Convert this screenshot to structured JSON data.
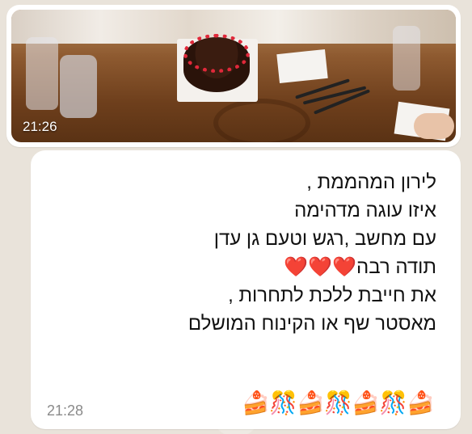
{
  "image_message": {
    "time": "21:26"
  },
  "text_message": {
    "lines": [
      "לירון המהממת ,",
      "איזו עוגה מדהימה",
      "עם מחשב ,רגש וטעם גן עדן",
      "תודה רבה❤️❤️❤️",
      "את חייבת ללכת לתחרות ,",
      "מאסטר שף או הקינוח המושלם"
    ],
    "emojis": [
      "🍰",
      "🎊",
      "🍰",
      "🎊",
      "🍰",
      "🎊",
      "🍰"
    ],
    "time": "21:28"
  },
  "colors": {
    "bubble": "#ffffff",
    "background": "#e9e3da",
    "time_text": "#8a8a8a"
  }
}
